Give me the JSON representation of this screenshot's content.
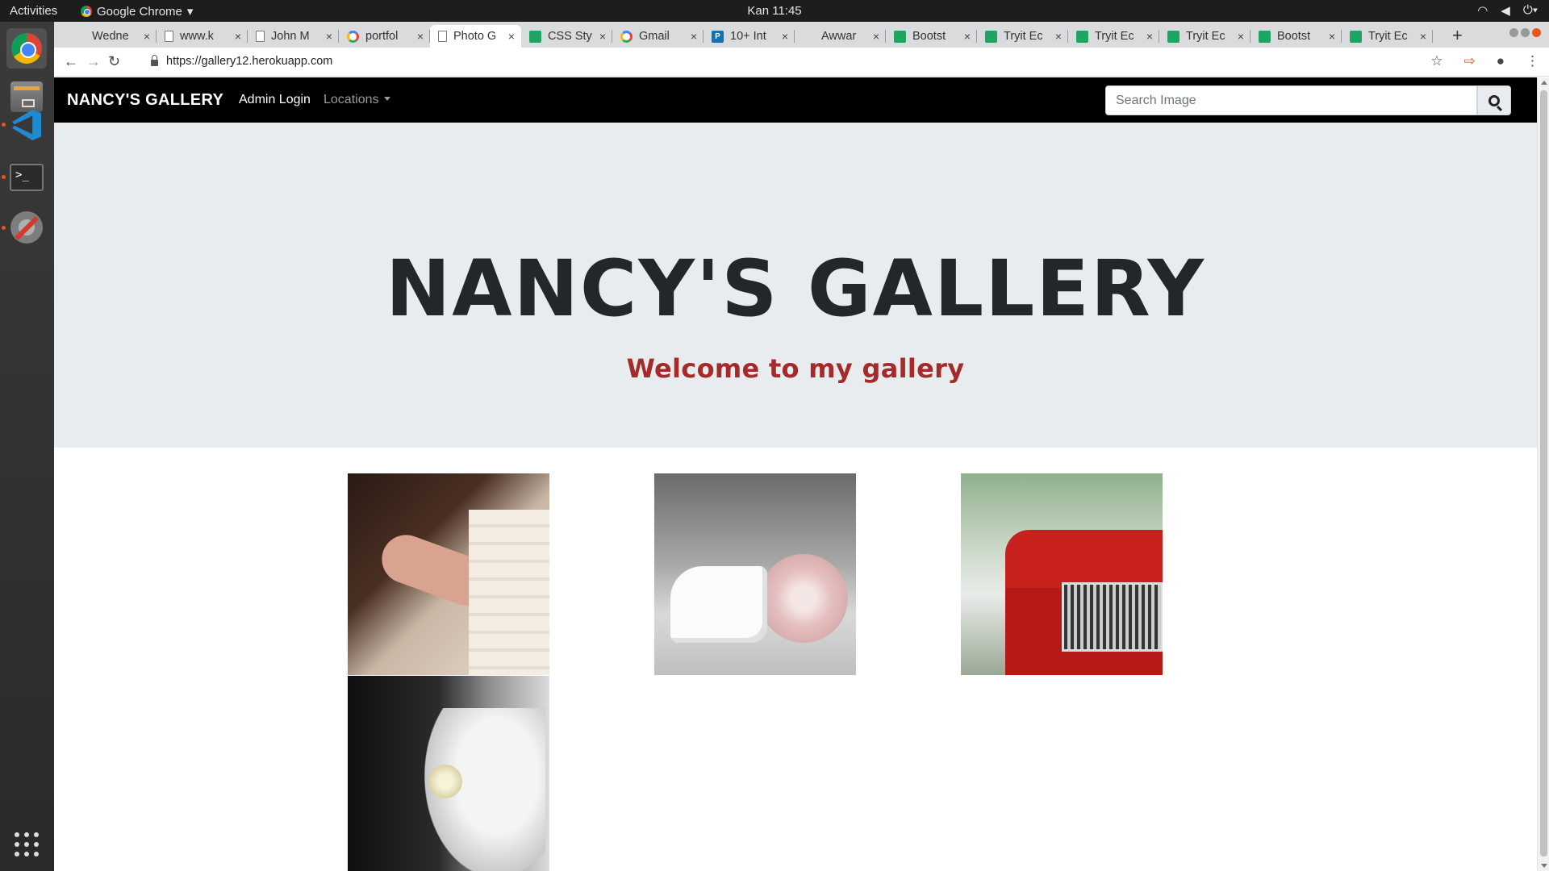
{
  "system": {
    "activities": "Activities",
    "app_name": "Google Chrome",
    "app_menu_arrow": "▾",
    "clock": "Kan 11:45",
    "tray_icons": [
      "wifi-icon",
      "volume-icon",
      "power-icon"
    ]
  },
  "dock": {
    "items": [
      "chrome",
      "files",
      "vscode",
      "terminal",
      "settings-tools",
      "show-apps"
    ]
  },
  "browser": {
    "tabs": [
      {
        "title": "Wedne",
        "favicon": "blank"
      },
      {
        "title": "www.k",
        "favicon": "doc"
      },
      {
        "title": "John M",
        "favicon": "doc"
      },
      {
        "title": "portfol",
        "favicon": "google"
      },
      {
        "title": "Photo G",
        "favicon": "doc",
        "active": true
      },
      {
        "title": "CSS Sty",
        "favicon": "sheet"
      },
      {
        "title": "Gmail",
        "favicon": "google"
      },
      {
        "title": "10+ Int",
        "favicon": "p"
      },
      {
        "title": "Awwar",
        "favicon": "blank"
      },
      {
        "title": "Bootst",
        "favicon": "sheet"
      },
      {
        "title": "Tryit Ec",
        "favicon": "sheet"
      },
      {
        "title": "Tryit Ec",
        "favicon": "sheet"
      },
      {
        "title": "Tryit Ec",
        "favicon": "sheet"
      },
      {
        "title": "Bootst",
        "favicon": "sheet"
      },
      {
        "title": "Tryit Ec",
        "favicon": "sheet"
      }
    ],
    "tab_close": "×",
    "new_tab": "+",
    "url": "https://gallery12.herokuapp.com",
    "nav": {
      "back": "←",
      "forward": "→",
      "reload": "↻"
    },
    "toolbar_icons": {
      "star": "☆",
      "extension": "⇨",
      "profile": "●",
      "menu": "⋮"
    }
  },
  "site": {
    "navbar": {
      "brand": "NANCY'S GALLERY",
      "admin_login": "Admin Login",
      "locations": "Locations",
      "search_placeholder": "Search Image"
    },
    "hero": {
      "title": "NANCY'S GALLERY",
      "subtitle": "Welcome to my gallery",
      "subtitle_color": "#a52a2a"
    },
    "gallery": [
      {
        "subject": "wedding ring on hand"
      },
      {
        "subject": "bridal shoes and bouquet"
      },
      {
        "subject": "couple with red vintage car"
      },
      {
        "subject": "bride with bouquet"
      }
    ]
  }
}
